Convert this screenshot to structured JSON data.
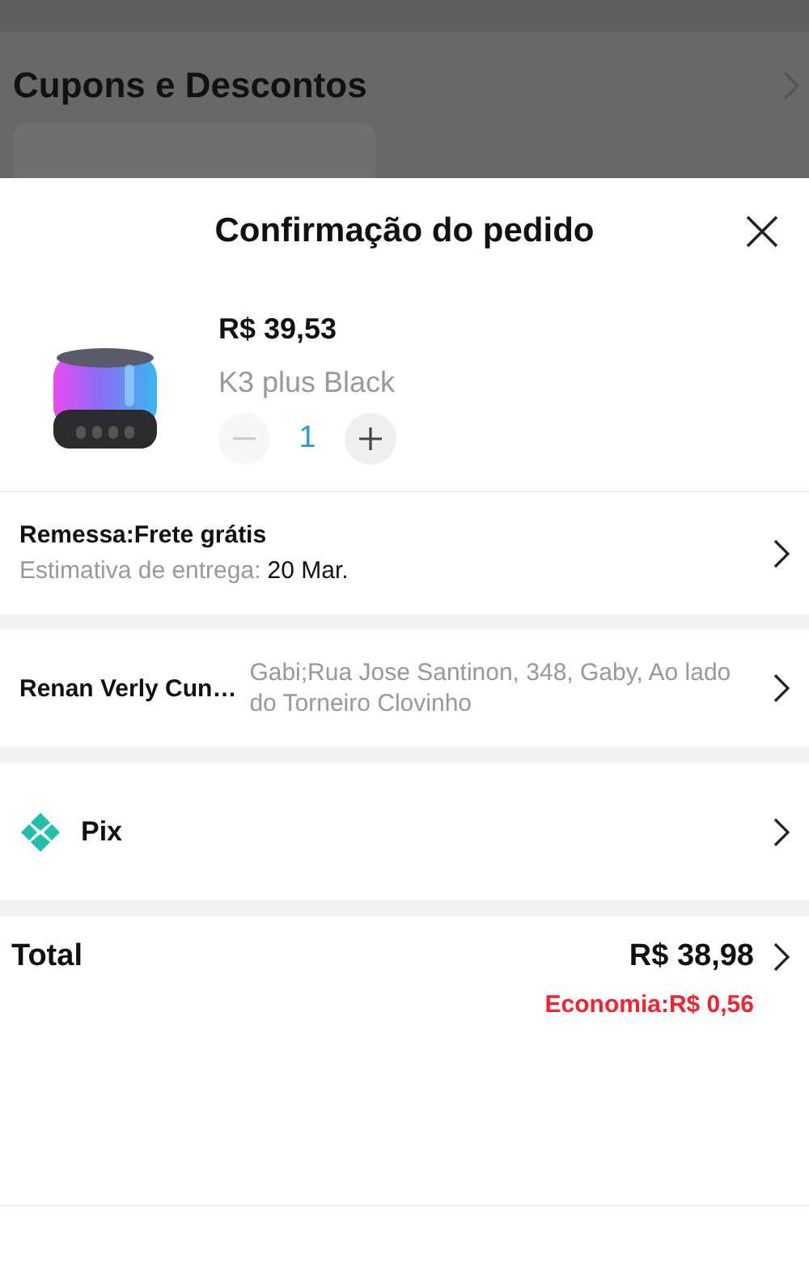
{
  "background": {
    "section_title": "Cupons e Descontos"
  },
  "sheet": {
    "title": "Confirmação do pedido",
    "product": {
      "price": "R$ 39,53",
      "variant": "K3 plus Black",
      "quantity": "1",
      "decrease_disabled": true
    },
    "shipping": {
      "label": "Remessa:Frete grátis",
      "estimate_label": "Estimativa de entrega:",
      "estimate_date": "20 Mar."
    },
    "address": {
      "name": "Renan Verly Cun…",
      "text": "Gabi;Rua Jose Santinon, 348, Gaby, Ao lado do Torneiro Clovinho"
    },
    "payment": {
      "method": "Pix"
    },
    "total": {
      "label": "Total",
      "amount": "R$ 38,98",
      "savings": "Economia:R$ 0,56"
    }
  }
}
